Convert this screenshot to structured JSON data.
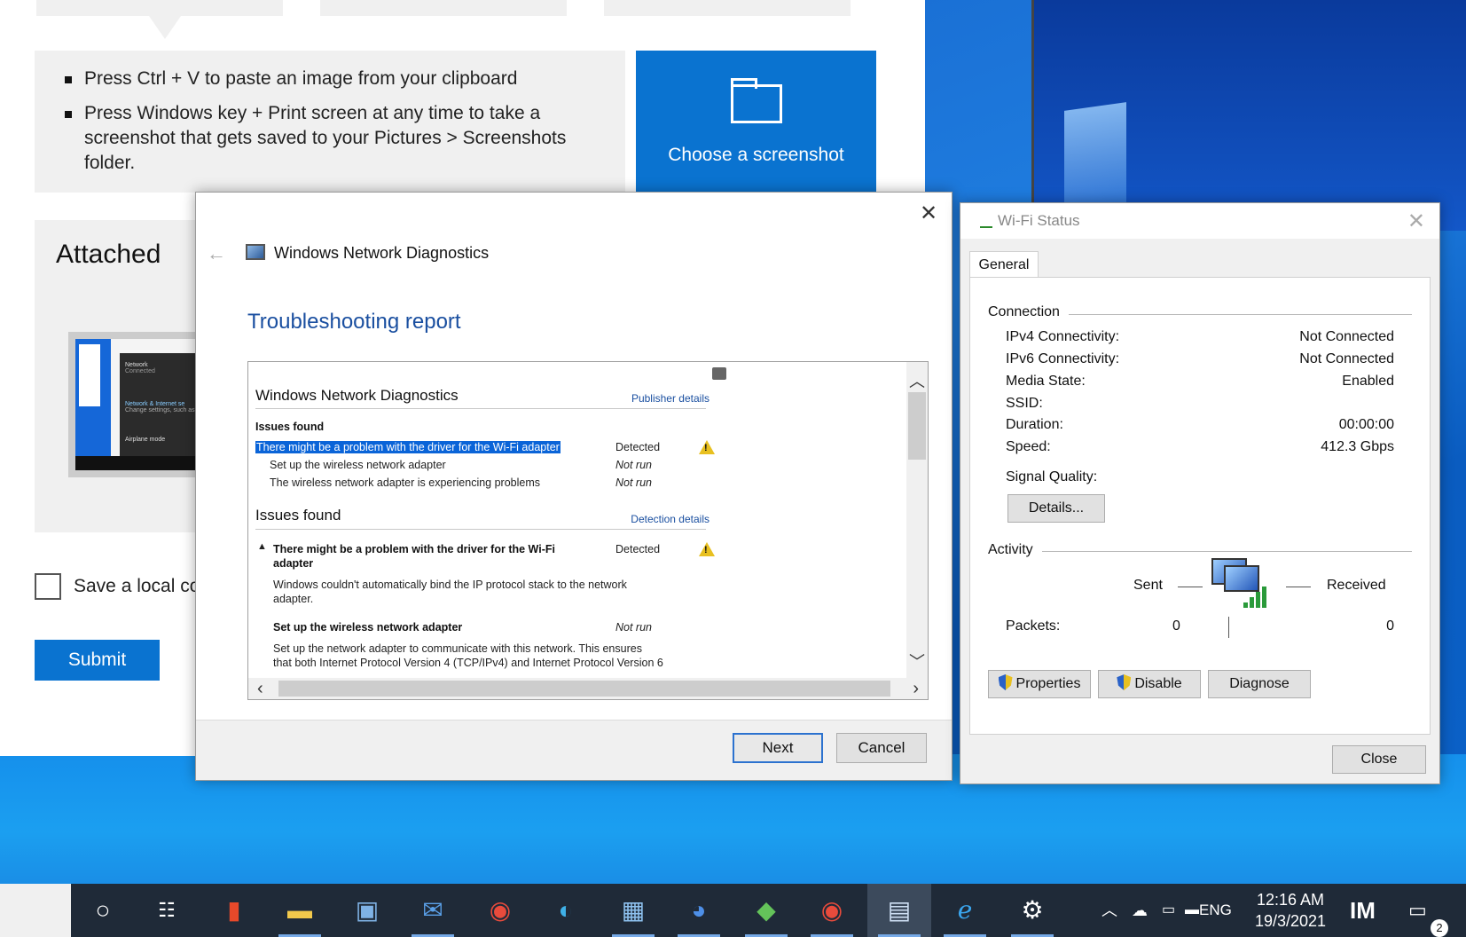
{
  "feedback": {
    "tips": [
      "Press Ctrl + V to paste an image from your clipboard",
      "Press Windows key + Print screen at any time to take a screenshot that gets saved to your Pictures > Screenshots folder."
    ],
    "choose_label": "Choose a screenshot",
    "attached_title": "Attached",
    "save_local_label": "Save a local co",
    "submit_label": "Submit",
    "thumb_network": "Network",
    "thumb_connected": "Connected",
    "thumb_network_internet": "Network & Internet se",
    "thumb_change": "Change settings, such as m",
    "thumb_airplane": "Airplane mode"
  },
  "diagnostics": {
    "window_title": "Windows Network Diagnostics",
    "heading": "Troubleshooting report",
    "report": {
      "section1_title": "Windows Network Diagnostics",
      "publisher_link": "Publisher details",
      "issues_found_label": "Issues found",
      "issue_main": "There might be a problem with the driver for the Wi-Fi adapter",
      "issue_main_status": "Detected",
      "sub1": "Set up the wireless network adapter",
      "sub1_status": "Not run",
      "sub2": "The wireless network adapter is experiencing problems",
      "sub2_status": "Not run",
      "section2_title": "Issues found",
      "detection_link": "Detection details",
      "detail1_title_a": "There might be a problem with the driver for the Wi-Fi",
      "detail1_title_b": "adapter",
      "detail1_status": "Detected",
      "detail1_desc_a": "Windows couldn't automatically bind the IP protocol stack to the network",
      "detail1_desc_b": "adapter.",
      "detail2_title": "Set up the wireless network adapter",
      "detail2_status": "Not run",
      "detail2_desc_a": "Set up the network adapter to communicate with this network. This ensures",
      "detail2_desc_b": "that both Internet Protocol Version 4 (TCP/IPv4) and Internet Protocol Version 6"
    },
    "next_label": "Next",
    "cancel_label": "Cancel"
  },
  "wifi": {
    "title": "Wi-Fi Status",
    "tab": "General",
    "connection_label": "Connection",
    "rows": [
      {
        "label": "IPv4 Connectivity:",
        "value": "Not Connected"
      },
      {
        "label": "IPv6 Connectivity:",
        "value": "Not Connected"
      },
      {
        "label": "Media State:",
        "value": "Enabled"
      },
      {
        "label": "SSID:",
        "value": ""
      },
      {
        "label": "Duration:",
        "value": "00:00:00"
      },
      {
        "label": "Speed:",
        "value": "412.3 Gbps"
      }
    ],
    "signal_label": "Signal Quality:",
    "details_label": "Details...",
    "activity_label": "Activity",
    "sent_label": "Sent",
    "received_label": "Received",
    "packets_label": "Packets:",
    "packets_sent": "0",
    "packets_received": "0",
    "properties_label": "Properties",
    "disable_label": "Disable",
    "diagnose_label": "Diagnose",
    "close_label": "Close"
  },
  "taskbar": {
    "lang": "ENG",
    "time": "12:16 AM",
    "date": "19/3/2021",
    "notifications": "2",
    "icons": [
      "cortana-icon",
      "task-view-icon",
      "office-icon",
      "file-explorer-icon",
      "store-icon",
      "mail-icon",
      "chrome-icon",
      "edge-icon",
      "control-panel-icon",
      "people-icon",
      "app-icon",
      "chrome-profile-icon",
      "network-diagnostics-icon",
      "internet-explorer-icon",
      "settings-icon"
    ]
  }
}
